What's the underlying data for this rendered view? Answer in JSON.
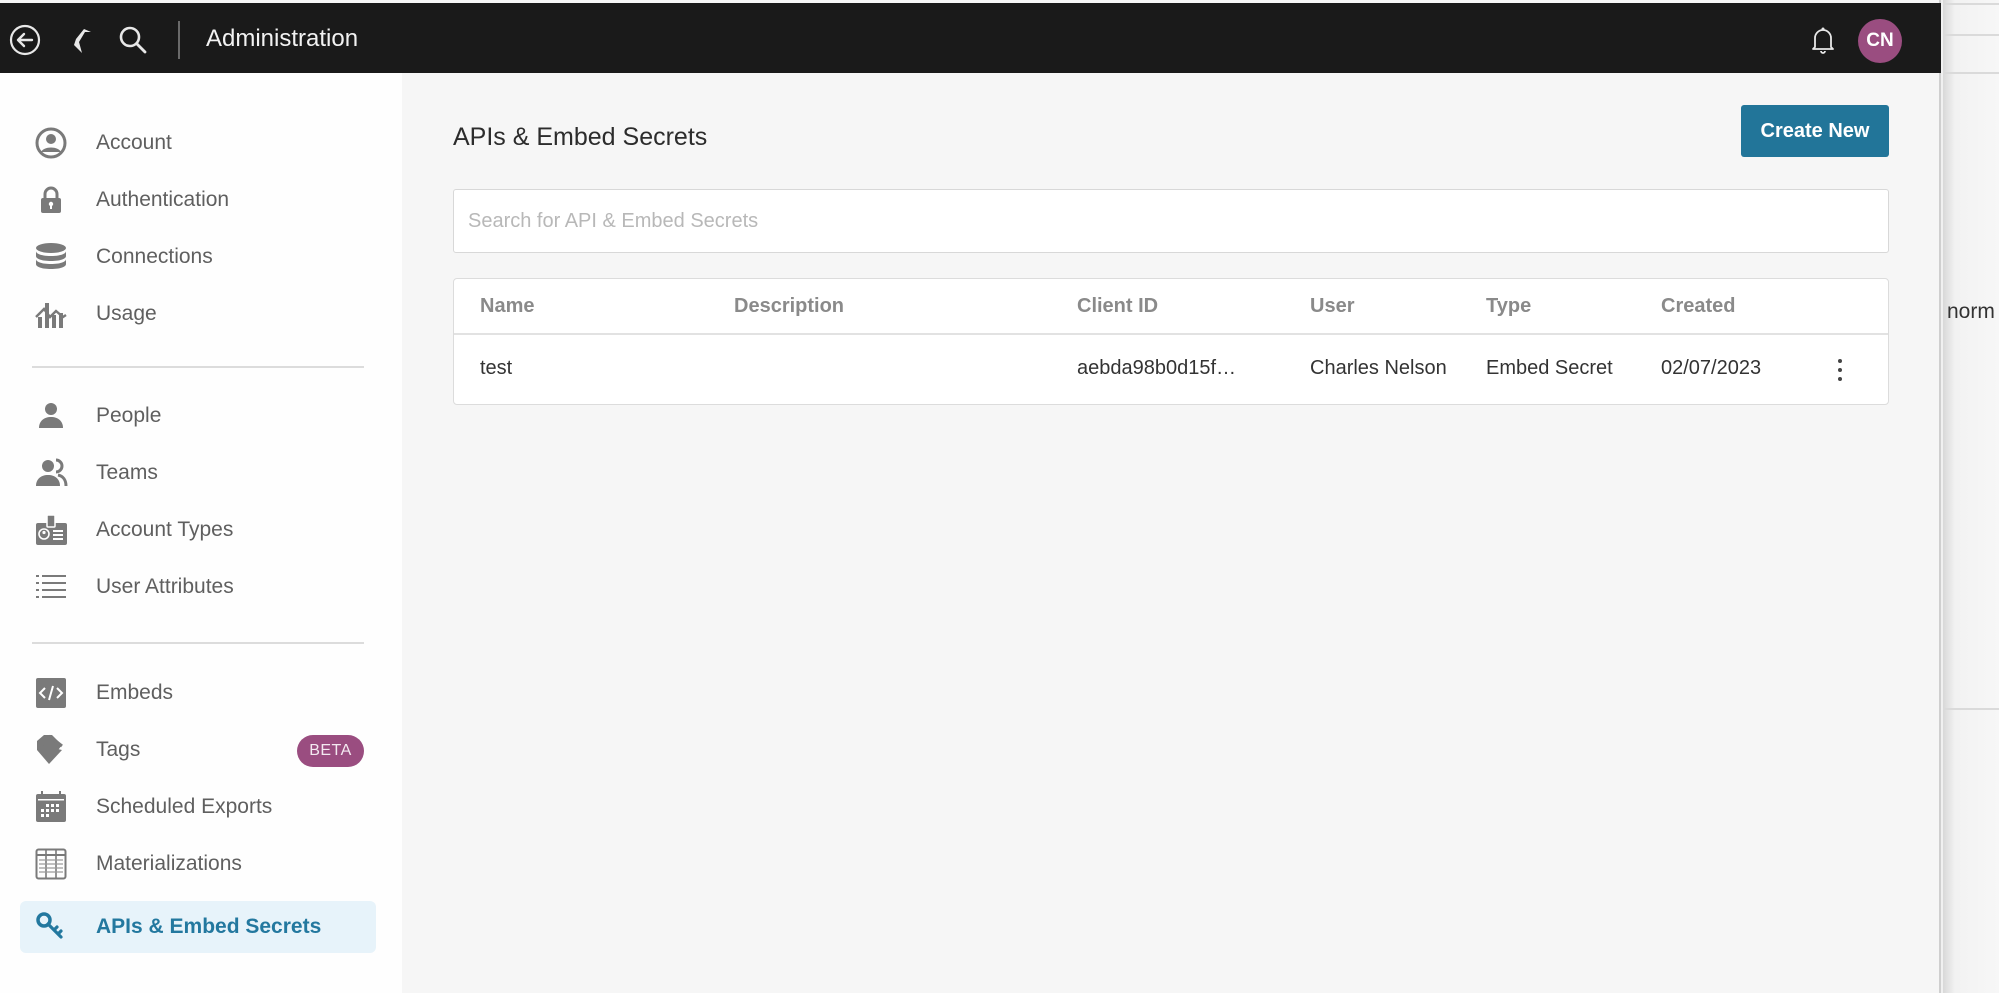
{
  "topbar": {
    "title": "Administration",
    "icons": [
      "back-arrow-icon",
      "bird-logo-icon",
      "search-icon",
      "bell-icon"
    ],
    "avatar_initials": "CN"
  },
  "sidebar": {
    "groups": [
      [
        {
          "label": "Account",
          "icon": "account-circle-icon"
        },
        {
          "label": "Authentication",
          "icon": "lock-icon"
        },
        {
          "label": "Connections",
          "icon": "database-icon"
        },
        {
          "label": "Usage",
          "icon": "usage-chart-icon"
        }
      ],
      [
        {
          "label": "People",
          "icon": "person-icon"
        },
        {
          "label": "Teams",
          "icon": "team-icon"
        },
        {
          "label": "Account Types",
          "icon": "id-badge-icon"
        },
        {
          "label": "User Attributes",
          "icon": "list-icon"
        }
      ],
      [
        {
          "label": "Embeds",
          "icon": "code-icon"
        },
        {
          "label": "Tags",
          "icon": "tag-icon",
          "badge": "BETA"
        },
        {
          "label": "Scheduled Exports",
          "icon": "calendar-icon"
        },
        {
          "label": "Materializations",
          "icon": "table-grid-icon"
        },
        {
          "label": "APIs & Embed Secrets",
          "icon": "key-icon",
          "active": true
        }
      ]
    ]
  },
  "main": {
    "title": "APIs & Embed Secrets",
    "create_button": "Create New",
    "search_placeholder": "Search for API & Embed Secrets",
    "search_value": "",
    "table": {
      "columns": [
        "Name",
        "Description",
        "Client ID",
        "User",
        "Type",
        "Created"
      ],
      "rows": [
        {
          "name": "test",
          "description": "",
          "client_id": "aebda98b0d15f…",
          "user": "Charles Nelson",
          "type": "Embed Secret",
          "created": "02/07/2023"
        }
      ]
    }
  },
  "background_window": {
    "partial_text": "norm"
  },
  "colors": {
    "accent": "#227599",
    "active_bg": "#e7f3fa",
    "avatar": "#9a4d80",
    "topbar": "#1a1a1a"
  }
}
